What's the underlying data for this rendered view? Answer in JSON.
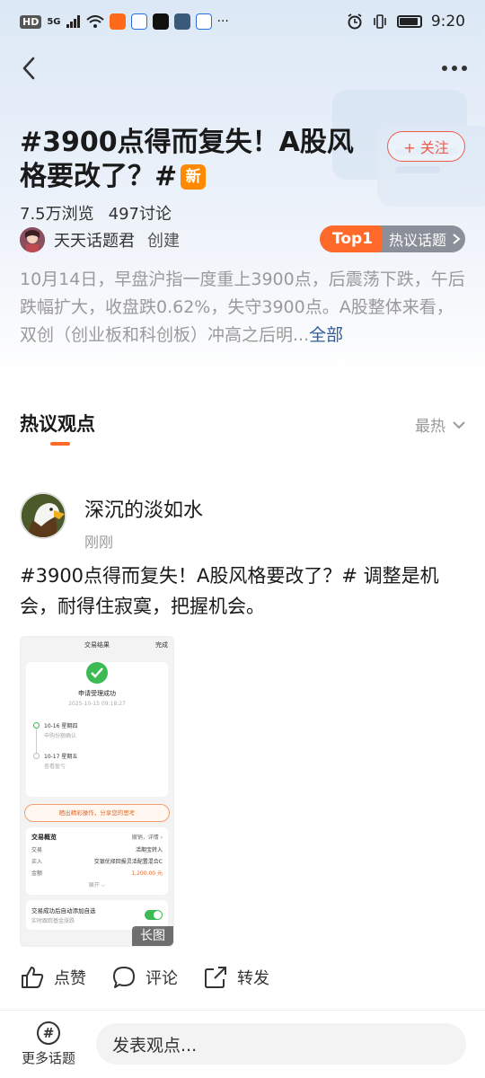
{
  "status_bar": {
    "network_label": "HD",
    "signal_label": "5G",
    "time": "9:20"
  },
  "topic": {
    "title": "#3900点得而复失！A股风格要改了？#",
    "new_badge": "新",
    "follow_label": "+ 关注",
    "views": "7.5万浏览",
    "discussions": "497讨论",
    "creator_name": "天天话题君",
    "creator_action": "创建",
    "rank_label": "Top1",
    "rank_category": "热议话题",
    "summary": "10月14日，早盘沪指一度重上3900点，后震荡下跌，午后跌幅扩大，收盘跌0.62%，失守3900点。A股整体来看，双创（创业板和科创板）冲高之后明...",
    "summary_more": "全部"
  },
  "section": {
    "title": "热议观点",
    "sort_label": "最热"
  },
  "post": {
    "author_name": "深沉的淡如水",
    "time": "刚刚",
    "text": " #3900点得而复失！A股风格要改了？# 调整是机会，耐得住寂寞，把握机会。",
    "image_tag": "长图",
    "image": {
      "header": "交易结果",
      "done": "完成",
      "success": "申请受理成功",
      "date": "2025-10-15 09:18:27",
      "step1_date": "10-16  星期四",
      "step1_sub": "申购份额确认",
      "step2_date": "10-17  星期五",
      "step2_sub": "查看盈亏",
      "share": "晒出精彩操作，分享您的思考",
      "overview_title": "交易概览",
      "overview_links": "撤销，详情 ›",
      "rows": [
        {
          "k": "交易",
          "v": "活期宝转入"
        },
        {
          "k": "买入",
          "v": "交银优择回报灵活配置混合C"
        },
        {
          "k": "金额",
          "v": "1,200.00 元"
        }
      ],
      "expand": "展开 ⌵",
      "toggle_label": "交易成功后自动添加自选",
      "toggle_sub": "实时跟踪基金涨跌"
    }
  },
  "actions": {
    "like": "点赞",
    "comment": "评论",
    "share": "转发"
  },
  "bottom": {
    "more_topics": "更多话题",
    "input_placeholder": "发表观点..."
  },
  "colors": {
    "accent": "#ff6a2a",
    "follow_red": "#ef5a4a",
    "link_blue": "#2f5d9a",
    "success_green": "#3cba54"
  }
}
